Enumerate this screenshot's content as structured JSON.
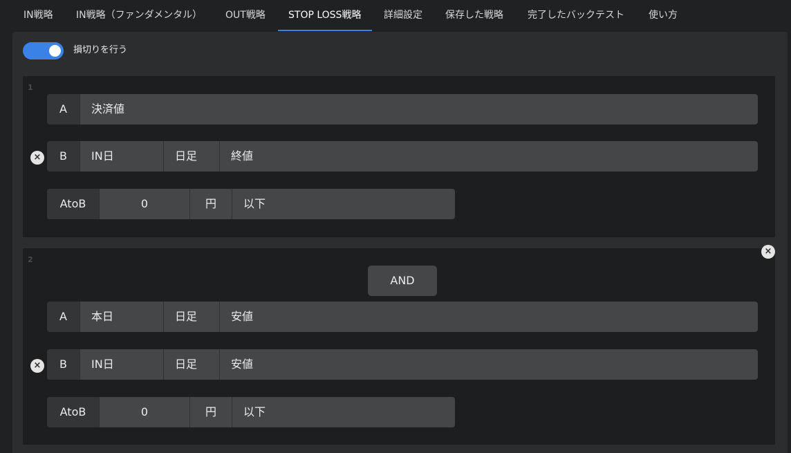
{
  "tabs": [
    {
      "label": "IN戦略"
    },
    {
      "label": "IN戦略（ファンダメンタル）"
    },
    {
      "label": "OUT戦略"
    },
    {
      "label": "STOP LOSS戦略"
    },
    {
      "label": "詳細設定"
    },
    {
      "label": "保存した戦略"
    },
    {
      "label": "完了したバックテスト"
    },
    {
      "label": "使い方"
    }
  ],
  "active_tab": "STOP LOSS戦略",
  "stoploss": {
    "toggle_on": true,
    "toggle_label": "損切りを行う"
  },
  "conditions": [
    {
      "number": "1",
      "a": {
        "label": "A",
        "value": "決済値"
      },
      "b": {
        "label": "B",
        "day": "IN日",
        "period": "日足",
        "price": "終値"
      },
      "compare": {
        "label": "AtoB",
        "amount": "0",
        "unit": "円",
        "operator": "以下"
      }
    },
    {
      "number": "2",
      "join": "AND",
      "a": {
        "label": "A",
        "day": "本日",
        "period": "日足",
        "price": "安値"
      },
      "b": {
        "label": "B",
        "day": "IN日",
        "period": "日足",
        "price": "安値"
      },
      "compare": {
        "label": "AtoB",
        "amount": "0",
        "unit": "円",
        "operator": "以下"
      }
    }
  ],
  "icons": {
    "remove": "×"
  },
  "colors": {
    "accent": "#3b82e6",
    "background": "#1f2122",
    "panel": "#2b2d2e",
    "field": "#444647"
  }
}
